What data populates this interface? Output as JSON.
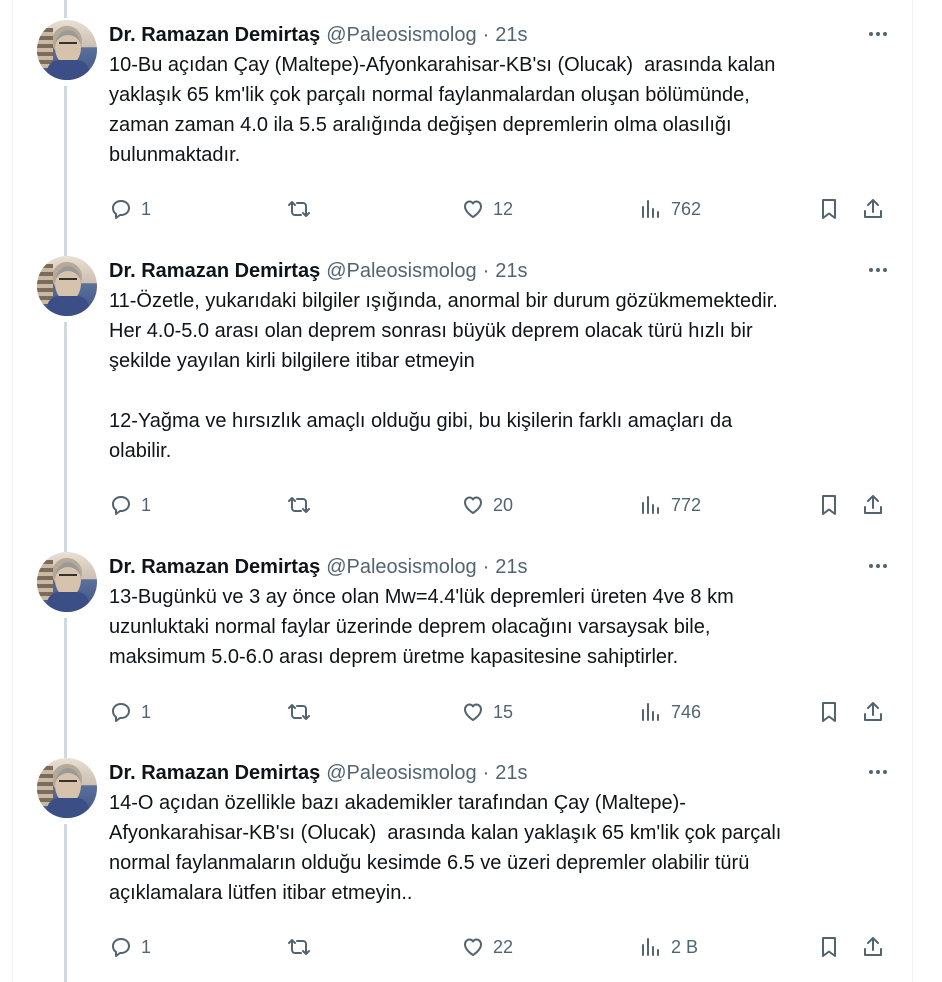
{
  "tweets": [
    {
      "author": "Dr. Ramazan Demirtaş",
      "handle": "@Paleosismolog",
      "separator": "·",
      "time": "21s",
      "text": "10-Bu açıdan Çay (Maltepe)-Afyonkarahisar-KB'sı (Olucak)  arasında kalan\nyaklaşık 65 km'lik çok parçalı normal faylanmalardan oluşan bölümünde,\nzaman zaman 4.0 ila 5.5 aralığında değişen depremlerin olma olasılığı\nbulunmaktadır.",
      "replies": "1",
      "retweets": "",
      "likes": "12",
      "views": "762"
    },
    {
      "author": "Dr. Ramazan Demirtaş",
      "handle": "@Paleosismolog",
      "separator": "·",
      "time": "21s",
      "text": "11-Özetle, yukarıdaki bilgiler ışığında, anormal bir durum gözükmemektedir.\nHer 4.0-5.0 arası olan deprem sonrası büyük deprem olacak türü hızlı bir\nşekilde yayılan kirli bilgilere itibar etmeyin\n\n12-Yağma ve hırsızlık amaçlı olduğu gibi, bu kişilerin farklı amaçları da\nolabilir.",
      "replies": "1",
      "retweets": "",
      "likes": "20",
      "views": "772"
    },
    {
      "author": "Dr. Ramazan Demirtaş",
      "handle": "@Paleosismolog",
      "separator": "·",
      "time": "21s",
      "text": "13-Bugünkü ve 3 ay önce olan Mw=4.4'lük depremleri üreten 4ve 8 km\nuzunluktaki normal faylar üzerinde deprem olacağını varsaysak bile,\nmaksimum 5.0-6.0 arası deprem üretme kapasitesine sahiptirler.",
      "replies": "1",
      "retweets": "",
      "likes": "15",
      "views": "746"
    },
    {
      "author": "Dr. Ramazan Demirtaş",
      "handle": "@Paleosismolog",
      "separator": "·",
      "time": "21s",
      "text": "14-O açıdan özellikle bazı akademikler tarafından Çay (Maltepe)-\nAfyonkarahisar-KB'sı (Olucak)  arasında kalan yaklaşık 65 km'lik çok parçalı\nnormal faylanmaların olduğu kesimde 6.5 ve üzeri depremler olabilir türü\naçıklamalara lütfen itibar etmeyin..",
      "replies": "1",
      "retweets": "",
      "likes": "22",
      "views": "2 B"
    }
  ],
  "icons": {
    "reply": "reply-icon",
    "retweet": "retweet-icon",
    "like": "heart-icon",
    "views": "views-icon",
    "bookmark": "bookmark-icon",
    "share": "share-icon",
    "more": "more-icon"
  },
  "colors": {
    "text": "#0f1419",
    "secondary": "#536471",
    "connector": "#cfd9de"
  }
}
